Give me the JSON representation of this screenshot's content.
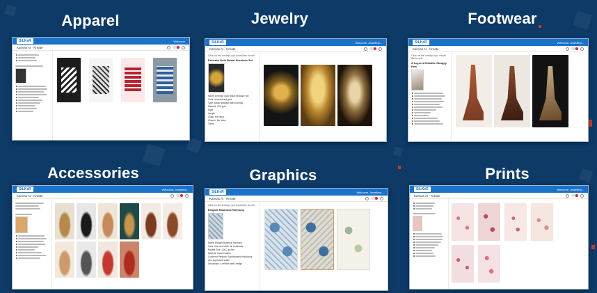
{
  "colors": {
    "background": "#0d3a66",
    "app_bar": "#1a73c8",
    "accent_red": "#d32f2f"
  },
  "app": {
    "logo": "SiLKeR",
    "welcome_short": "Welcome",
    "welcome_long": "Welcome, Jewellery...",
    "subtitle": "Kanvas AI - Kreate"
  },
  "sections": [
    {
      "heading": "Apparel"
    },
    {
      "heading": "Jewelry",
      "hint": "Click on the concept you would like to edit",
      "concept_title": "Emerald Gold Bridal Necklace Set",
      "attributes": [
        "Name: Emerald Gold Bridal Necklace Set",
        "Color: emerald and gold",
        "Type: Bridal Necklace with Earrings",
        "Material: 22K gold",
        "Style",
        "Length",
        "Clasp: fire clasp",
        "Closure: fire clasp",
        "Tones"
      ]
    },
    {
      "heading": "Footwear",
      "hint": "Click on the concept you would like to edit",
      "concept_title": "A Layered Metallic Strappy Heel"
    },
    {
      "heading": "Accessories"
    },
    {
      "heading": "Graphics",
      "hint": "Click on the concept you would like to edit",
      "concept_title": "Elegant Botanical Harmony",
      "attributes": [
        "Name: Elegant Botanical Harmony",
        "Color: blue and white fan botanicals",
        "Repeat Size: 12x12 inches",
        "Material: Cotton sateen",
        "Customer Persona: Sophisticated individuals who appreciate subtle",
        "Description: A refined fabric design"
      ]
    },
    {
      "heading": "Prints"
    }
  ]
}
